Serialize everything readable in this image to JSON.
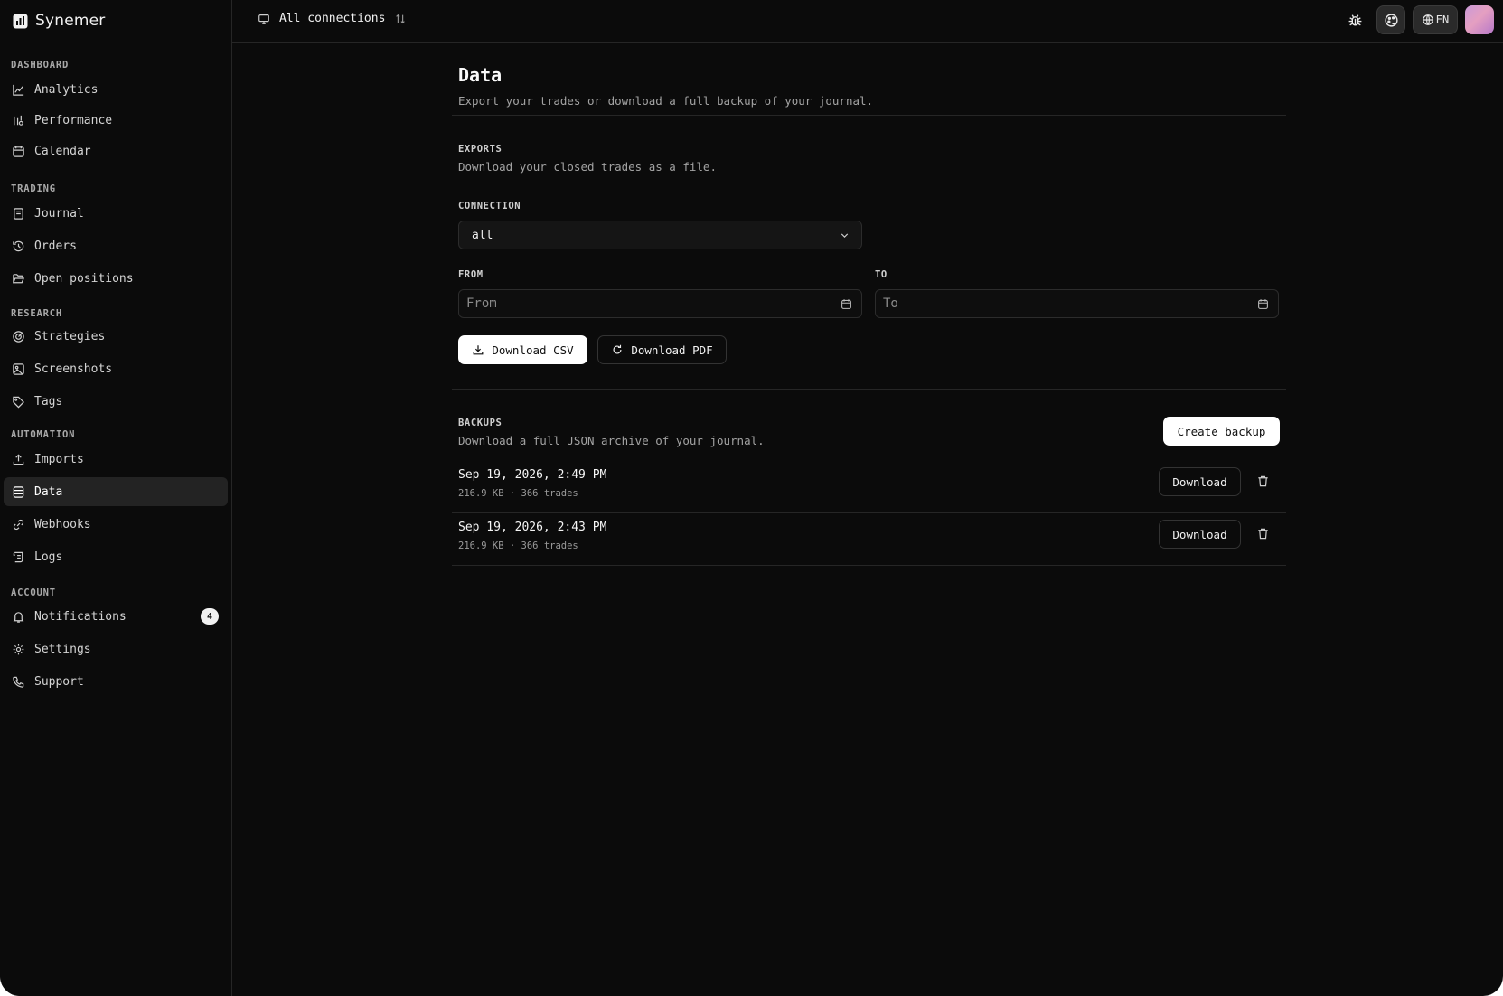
{
  "brand": {
    "name": "Synemer"
  },
  "sidebar": {
    "groups": [
      {
        "label": "DASHBOARD",
        "items": [
          {
            "label": "Analytics",
            "icon": "chart-line-icon"
          },
          {
            "label": "Performance",
            "icon": "performance-icon"
          },
          {
            "label": "Calendar",
            "icon": "calendar-icon"
          }
        ]
      },
      {
        "label": "TRADING",
        "items": [
          {
            "label": "Journal",
            "icon": "journal-icon"
          },
          {
            "label": "Orders",
            "icon": "history-icon"
          },
          {
            "label": "Open positions",
            "icon": "folder-open-icon"
          }
        ]
      },
      {
        "label": "RESEARCH",
        "items": [
          {
            "label": "Strategies",
            "icon": "target-icon"
          },
          {
            "label": "Screenshots",
            "icon": "image-icon"
          },
          {
            "label": "Tags",
            "icon": "tag-icon"
          }
        ]
      },
      {
        "label": "AUTOMATION",
        "items": [
          {
            "label": "Imports",
            "icon": "upload-icon"
          },
          {
            "label": "Data",
            "icon": "database-icon",
            "active": true
          },
          {
            "label": "Webhooks",
            "icon": "link-icon"
          },
          {
            "label": "Logs",
            "icon": "scroll-icon"
          }
        ]
      },
      {
        "label": "ACCOUNT",
        "items": [
          {
            "label": "Notifications",
            "icon": "bell-icon",
            "badge": "4"
          },
          {
            "label": "Settings",
            "icon": "gear-icon"
          },
          {
            "label": "Support",
            "icon": "phone-icon"
          }
        ]
      }
    ]
  },
  "topbar": {
    "connection_label": "All connections",
    "language": "EN"
  },
  "page": {
    "title": "Data",
    "subtitle": "Export your trades or download a full backup of your journal."
  },
  "exports": {
    "label": "EXPORTS",
    "description": "Download your closed trades as a file.",
    "connection_label": "CONNECTION",
    "connection_value": "all",
    "from_label": "FROM",
    "from_placeholder": "From",
    "to_label": "TO",
    "to_placeholder": "To",
    "csv_button": "Download CSV",
    "pdf_button": "Download PDF"
  },
  "backups": {
    "label": "BACKUPS",
    "description": "Download a full JSON archive of your journal.",
    "create_button": "Create backup",
    "download_label": "Download",
    "items": [
      {
        "date": "Sep 19, 2026, 2:49 PM",
        "meta": "216.9 KB · 366 trades"
      },
      {
        "date": "Sep 19, 2026, 2:43 PM",
        "meta": "216.9 KB · 366 trades"
      }
    ]
  },
  "colors": {
    "background": "#0b0b0b",
    "border": "#262626",
    "active_nav": "#232323",
    "text_primary": "#f2f2f2",
    "text_muted": "#a3a3a3"
  }
}
